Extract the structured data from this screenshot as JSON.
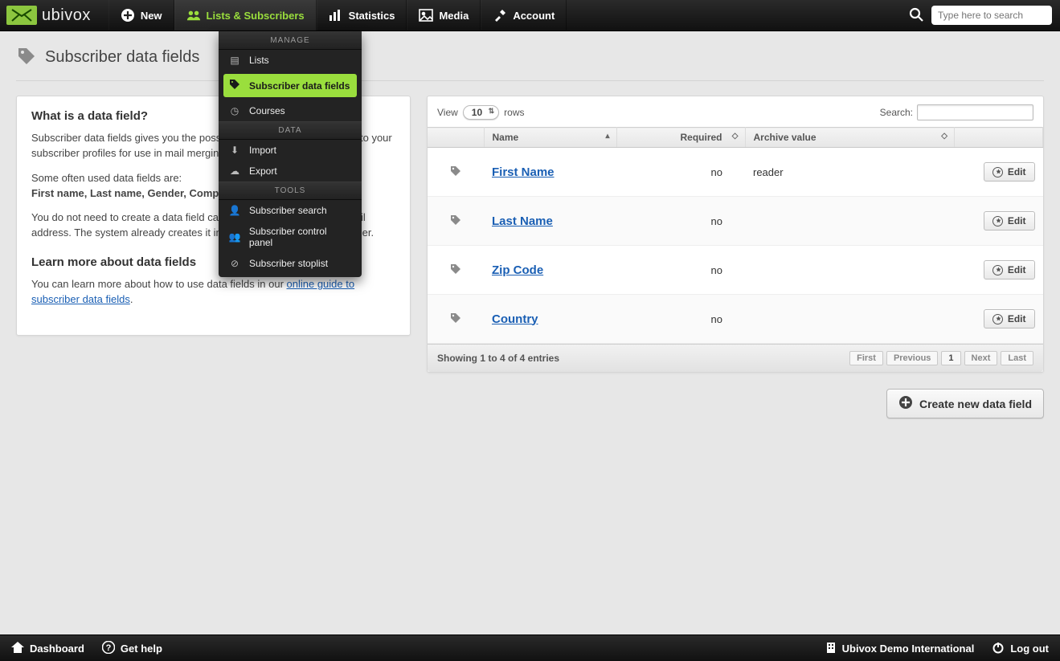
{
  "brand": "ubivox",
  "topnav": {
    "new": "New",
    "lists": "Lists & Subscribers",
    "stats": "Statistics",
    "media": "Media",
    "account": "Account",
    "search_placeholder": "Type here to search"
  },
  "dropdown": {
    "sections": {
      "manage": "MANAGE",
      "data": "DATA",
      "tools": "TOOLS"
    },
    "lists": "Lists",
    "sdf": "Subscriber data fields",
    "courses": "Courses",
    "import": "Import",
    "export": "Export",
    "search": "Subscriber search",
    "panel": "Subscriber control panel",
    "stoplist": "Subscriber stoplist"
  },
  "page_title": "Subscriber data fields",
  "info": {
    "h_what": "What is a data field?",
    "p1": "Subscriber data fields gives you the possibility to add extra information to your subscriber profiles for use in mail merging or segmentation.",
    "p2a": "Some often used data fields are:",
    "p2b": "First name, Last name, Gender, Company and age.",
    "p3": "You do not need to create a data field called e-mail containing the e-mail address. The system already creates it internally to identify the subscriber.",
    "h_learn": "Learn more about data fields",
    "p4a": "You can learn more about how to use data fields in our ",
    "p4link": "online guide to subscriber data fields",
    "p4b": "."
  },
  "table": {
    "view": "View",
    "rows_label": "rows",
    "rows_value": "10",
    "search_label": "Search:",
    "cols": {
      "name": "Name",
      "required": "Required",
      "archive": "Archive value"
    },
    "edit": "Edit",
    "rows": [
      {
        "name": "First Name",
        "required": "no",
        "archive": "reader"
      },
      {
        "name": "Last Name",
        "required": "no",
        "archive": ""
      },
      {
        "name": "Zip Code",
        "required": "no",
        "archive": ""
      },
      {
        "name": "Country",
        "required": "no",
        "archive": ""
      }
    ],
    "status": "Showing 1 to 4 of 4 entries",
    "pager": {
      "first": "First",
      "prev": "Previous",
      "one": "1",
      "next": "Next",
      "last": "Last"
    }
  },
  "create_btn": "Create new data field",
  "bottom": {
    "dashboard": "Dashboard",
    "help": "Get help",
    "org": "Ubivox Demo International",
    "logout": "Log out"
  }
}
